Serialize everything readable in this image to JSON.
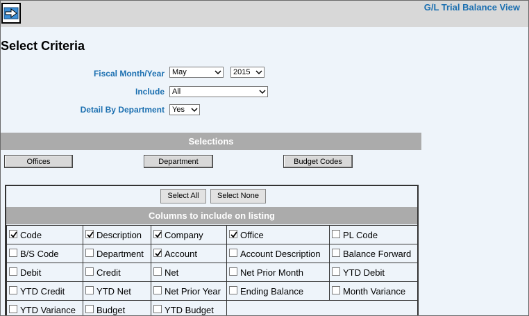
{
  "header": {
    "title": "G/L Trial Balance View",
    "back_icon": "arrow-right-icon"
  },
  "page": {
    "heading": "Select Criteria"
  },
  "criteria": {
    "fiscal_label": "Fiscal Month/Year",
    "month_value": "May",
    "year_value": "2015",
    "include_label": "Include",
    "include_value": "All",
    "detail_label": "Detail By Department",
    "detail_value": "Yes"
  },
  "selections": {
    "title": "Selections",
    "offices_label": "Offices",
    "department_label": "Department",
    "budget_codes_label": "Budget Codes"
  },
  "columns_panel": {
    "select_all_label": "Select All",
    "select_none_label": "Select None",
    "title": "Columns to include on listing",
    "rows": [
      [
        {
          "label": "Code",
          "checked": true
        },
        {
          "label": "Description",
          "checked": true
        },
        {
          "label": "Company",
          "checked": true
        },
        {
          "label": "Office",
          "checked": true
        },
        {
          "label": "PL Code",
          "checked": false
        }
      ],
      [
        {
          "label": "B/S Code",
          "checked": false
        },
        {
          "label": "Department",
          "checked": false
        },
        {
          "label": "Account",
          "checked": true
        },
        {
          "label": "Account Description",
          "checked": false
        },
        {
          "label": "Balance Forward",
          "checked": false
        }
      ],
      [
        {
          "label": "Debit",
          "checked": false
        },
        {
          "label": "Credit",
          "checked": false
        },
        {
          "label": "Net",
          "checked": false
        },
        {
          "label": "Net Prior Month",
          "checked": false
        },
        {
          "label": "YTD Debit",
          "checked": false
        }
      ],
      [
        {
          "label": "YTD Credit",
          "checked": false
        },
        {
          "label": "YTD Net",
          "checked": false
        },
        {
          "label": "Net Prior Year",
          "checked": false
        },
        {
          "label": "Ending Balance",
          "checked": false
        },
        {
          "label": "Month Variance",
          "checked": false
        }
      ],
      [
        {
          "label": "YTD Variance",
          "checked": false
        },
        {
          "label": "Budget",
          "checked": false
        },
        {
          "label": "YTD Budget",
          "checked": false
        }
      ]
    ]
  }
}
